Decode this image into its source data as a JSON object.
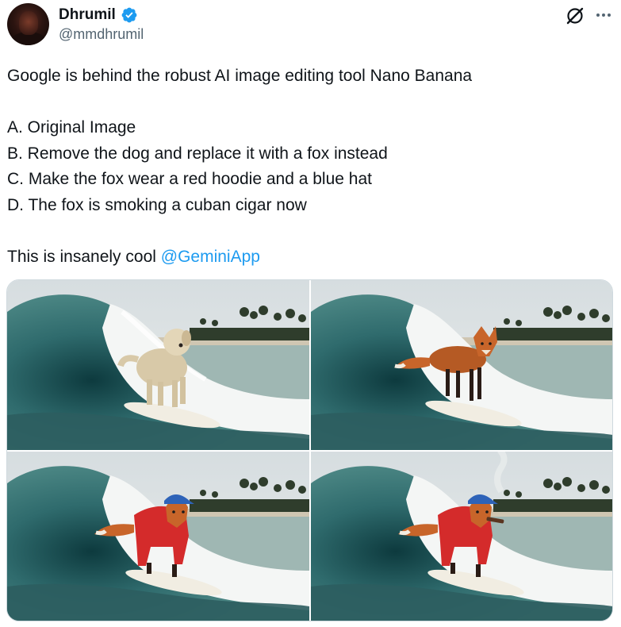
{
  "author": {
    "display_name": "Dhrumil",
    "handle": "@mmdhrumil",
    "verified": true
  },
  "icons": {
    "avatar": "profile-photo",
    "verified": "verified-badge-icon",
    "grok": "grok-icon",
    "more": "more-options-icon"
  },
  "colors": {
    "text": "#0f1419",
    "secondary": "#536471",
    "link": "#1d9bf0",
    "verified": "#1d9bf0"
  },
  "tweet": {
    "line1": "Google is behind the robust AI image editing tool Nano Banana",
    "line_a": "A. Original Image",
    "line_b": "B. Remove the dog and replace it with a fox instead",
    "line_c": "C. Make the fox wear a red hoodie and a blue hat",
    "line_d": "D. The fox is smoking a cuban cigar now",
    "closing": "This is insanely cool ",
    "mention": "@GeminiApp"
  },
  "media": [
    {
      "subject": "dog-surfing-photo"
    },
    {
      "subject": "fox-surfing-photo"
    },
    {
      "subject": "fox-red-hoodie-blue-hat-surfing-photo"
    },
    {
      "subject": "fox-smoking-cigar-surfing-photo"
    }
  ]
}
